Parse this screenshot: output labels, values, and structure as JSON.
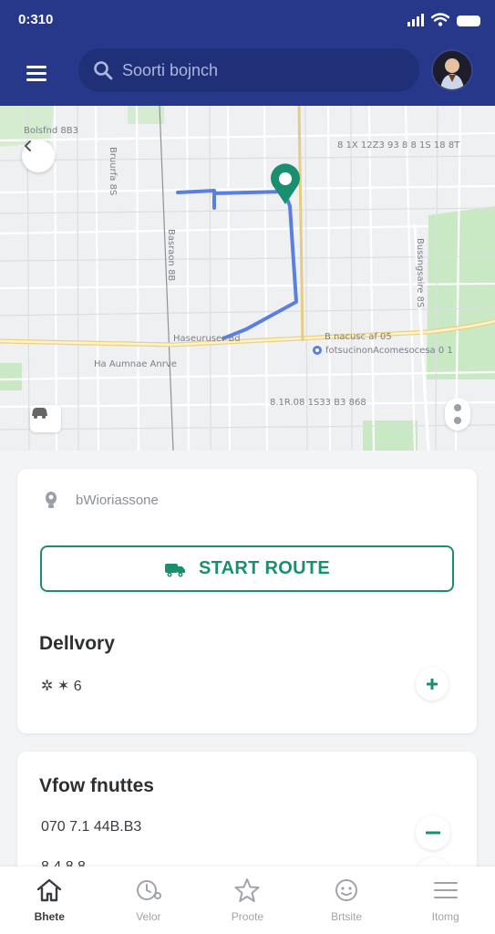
{
  "status_bar": {
    "time": "0:310"
  },
  "header": {
    "search_placeholder": "Soorti bojnch"
  },
  "map": {
    "labels": [
      "Bolsfnd 8B3",
      "8 1X 12Z3 93 8 8 1S 18 8T",
      "Haseuruser Bd",
      "B nacusc af 05",
      "fotsucinonAcomesocesa 0 1",
      "Ha Aumnae Anrve",
      "8.1R.08 1S33 B3 868"
    ],
    "vertical_labels": [
      "Bruurfa 8S",
      "Basraon 8B",
      "Bussngsaire 8S"
    ]
  },
  "route_card": {
    "location_text": "bWioriassone",
    "start_button_label": "START ROUTE",
    "delivery_title": "Dellvory",
    "delivery_detail": "✲ ✶ 6"
  },
  "routes_card": {
    "title": "Vfow fnuttes",
    "items": [
      "070 7.1 44B.B3",
      "8 4 8 8"
    ]
  },
  "tab_bar": {
    "tabs": [
      {
        "label": "Bhete",
        "icon": "home-icon",
        "active": true
      },
      {
        "label": "Velor",
        "icon": "timer-icon",
        "active": false
      },
      {
        "label": "Proote",
        "icon": "star-icon",
        "active": false
      },
      {
        "label": "Brtsite",
        "icon": "smiley-icon",
        "active": false
      },
      {
        "label": "Itomg",
        "icon": "menu-lines-icon",
        "active": false
      }
    ]
  },
  "colors": {
    "brand": "#27388a",
    "accent": "#1a8f6f",
    "route": "#5b7fe0"
  }
}
